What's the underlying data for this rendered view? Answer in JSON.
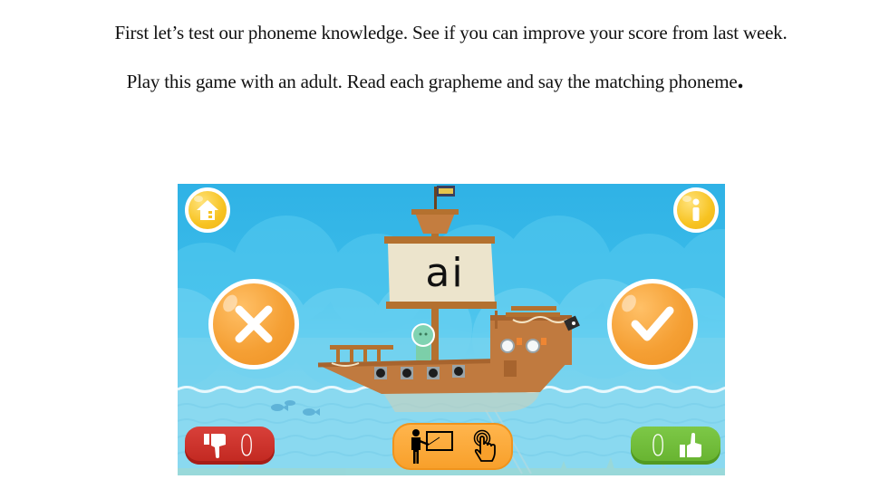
{
  "instructions": {
    "line1": "First let’s test our phoneme knowledge. See if you can improve your score from last week.",
    "line2": "Play this game with an adult. Read each grapheme and say the matching phoneme",
    "line2_end": "."
  },
  "game": {
    "grapheme": "ai",
    "buttons": {
      "home": "home-icon",
      "info": "info-icon",
      "wrong": "cross-icon",
      "right": "check-icon",
      "teach": "teacher-and-tap-icons"
    },
    "scores": {
      "incorrect": "0",
      "correct": "0"
    },
    "colors": {
      "sky": "#2fb2e6",
      "sea": "#8edaf0",
      "yellow_button": "#f7c321",
      "orange_button": "#f5a035",
      "red_score": "#c8302a",
      "green_score": "#70bb38",
      "ship_wood": "#c07a3f",
      "sail": "#ece4cc"
    }
  }
}
